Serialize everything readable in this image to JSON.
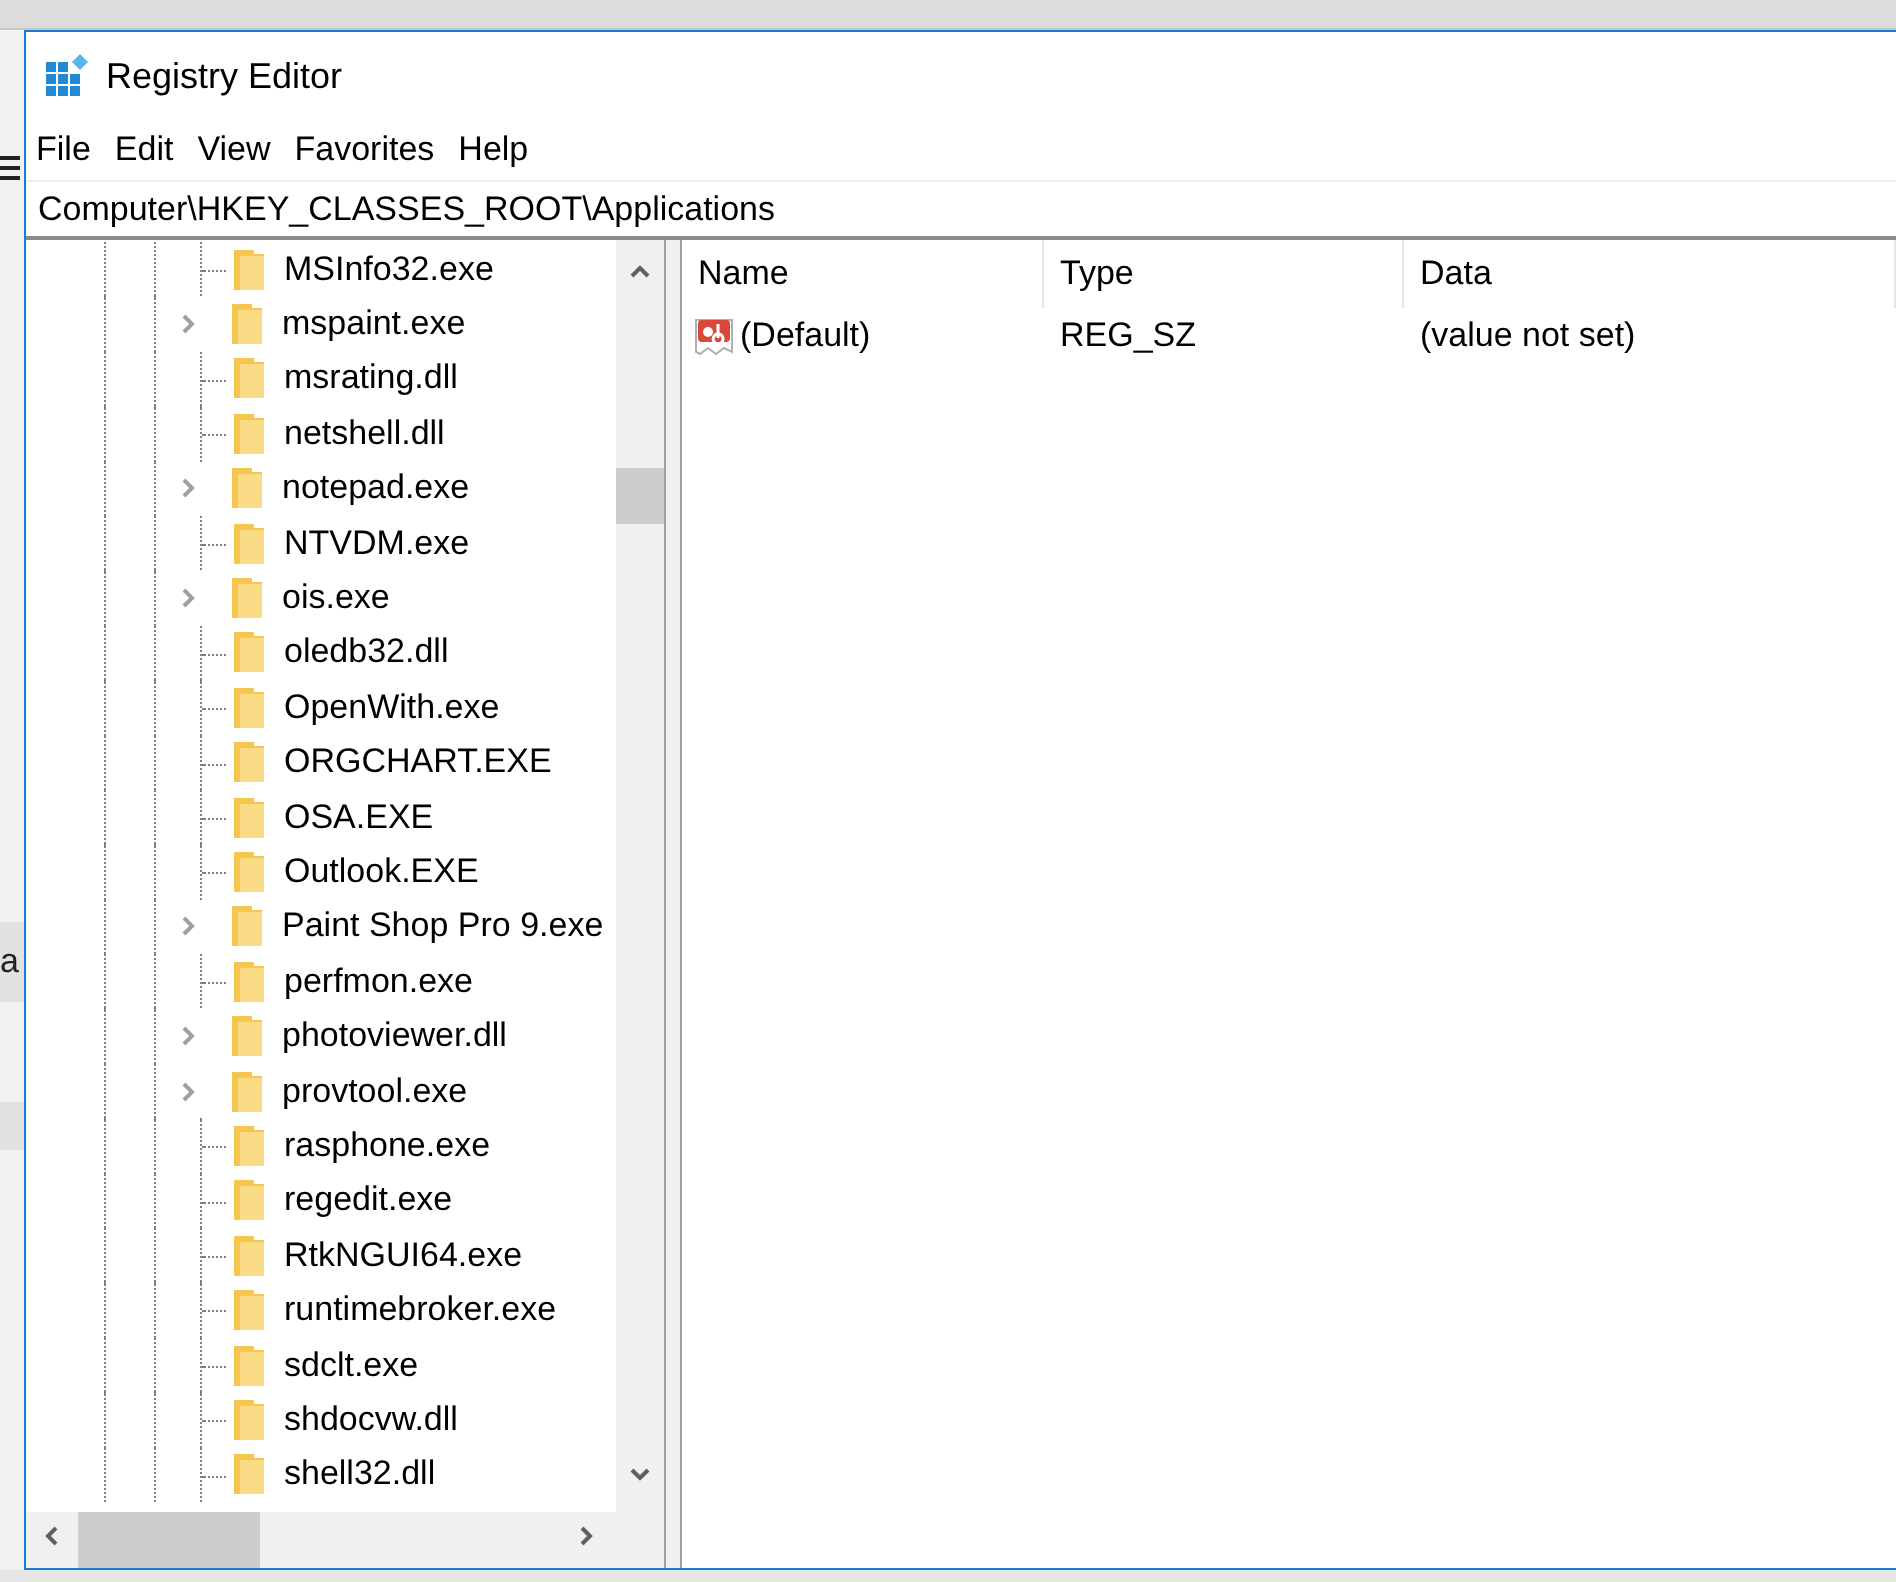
{
  "background_fragment": "a",
  "window": {
    "title": "Registry Editor"
  },
  "menu": [
    "File",
    "Edit",
    "View",
    "Favorites",
    "Help"
  ],
  "address": "Computer\\HKEY_CLASSES_ROOT\\Applications",
  "tree": {
    "items": [
      {
        "label": "MSInfo32.exe",
        "expandable": false,
        "selected": false
      },
      {
        "label": "mspaint.exe",
        "expandable": true,
        "selected": false
      },
      {
        "label": "msrating.dll",
        "expandable": false,
        "selected": false
      },
      {
        "label": "netshell.dll",
        "expandable": false,
        "selected": false
      },
      {
        "label": "notepad.exe",
        "expandable": true,
        "selected": false
      },
      {
        "label": "NTVDM.exe",
        "expandable": false,
        "selected": false
      },
      {
        "label": "ois.exe",
        "expandable": true,
        "selected": false
      },
      {
        "label": "oledb32.dll",
        "expandable": false,
        "selected": false
      },
      {
        "label": "OpenWith.exe",
        "expandable": false,
        "selected": false
      },
      {
        "label": "ORGCHART.EXE",
        "expandable": false,
        "selected": false
      },
      {
        "label": "OSA.EXE",
        "expandable": false,
        "selected": false
      },
      {
        "label": "Outlook.EXE",
        "expandable": false,
        "selected": false
      },
      {
        "label": "Paint Shop Pro 9.exe",
        "expandable": true,
        "selected": false
      },
      {
        "label": "perfmon.exe",
        "expandable": false,
        "selected": false
      },
      {
        "label": "photoviewer.dll",
        "expandable": true,
        "selected": false
      },
      {
        "label": "provtool.exe",
        "expandable": true,
        "selected": false
      },
      {
        "label": "rasphone.exe",
        "expandable": false,
        "selected": false
      },
      {
        "label": "regedit.exe",
        "expandable": false,
        "selected": false
      },
      {
        "label": "RtkNGUI64.exe",
        "expandable": false,
        "selected": false
      },
      {
        "label": "runtimebroker.exe",
        "expandable": false,
        "selected": false
      },
      {
        "label": "sdclt.exe",
        "expandable": false,
        "selected": false
      },
      {
        "label": "shdocvw.dll",
        "expandable": false,
        "selected": false
      },
      {
        "label": "shell32.dll",
        "expandable": false,
        "selected": false
      }
    ]
  },
  "values": {
    "columns": [
      "Name",
      "Type",
      "Data"
    ],
    "rows": [
      {
        "name": "(Default)",
        "type": "REG_SZ",
        "data": "(value not set)",
        "selected": false
      }
    ]
  }
}
